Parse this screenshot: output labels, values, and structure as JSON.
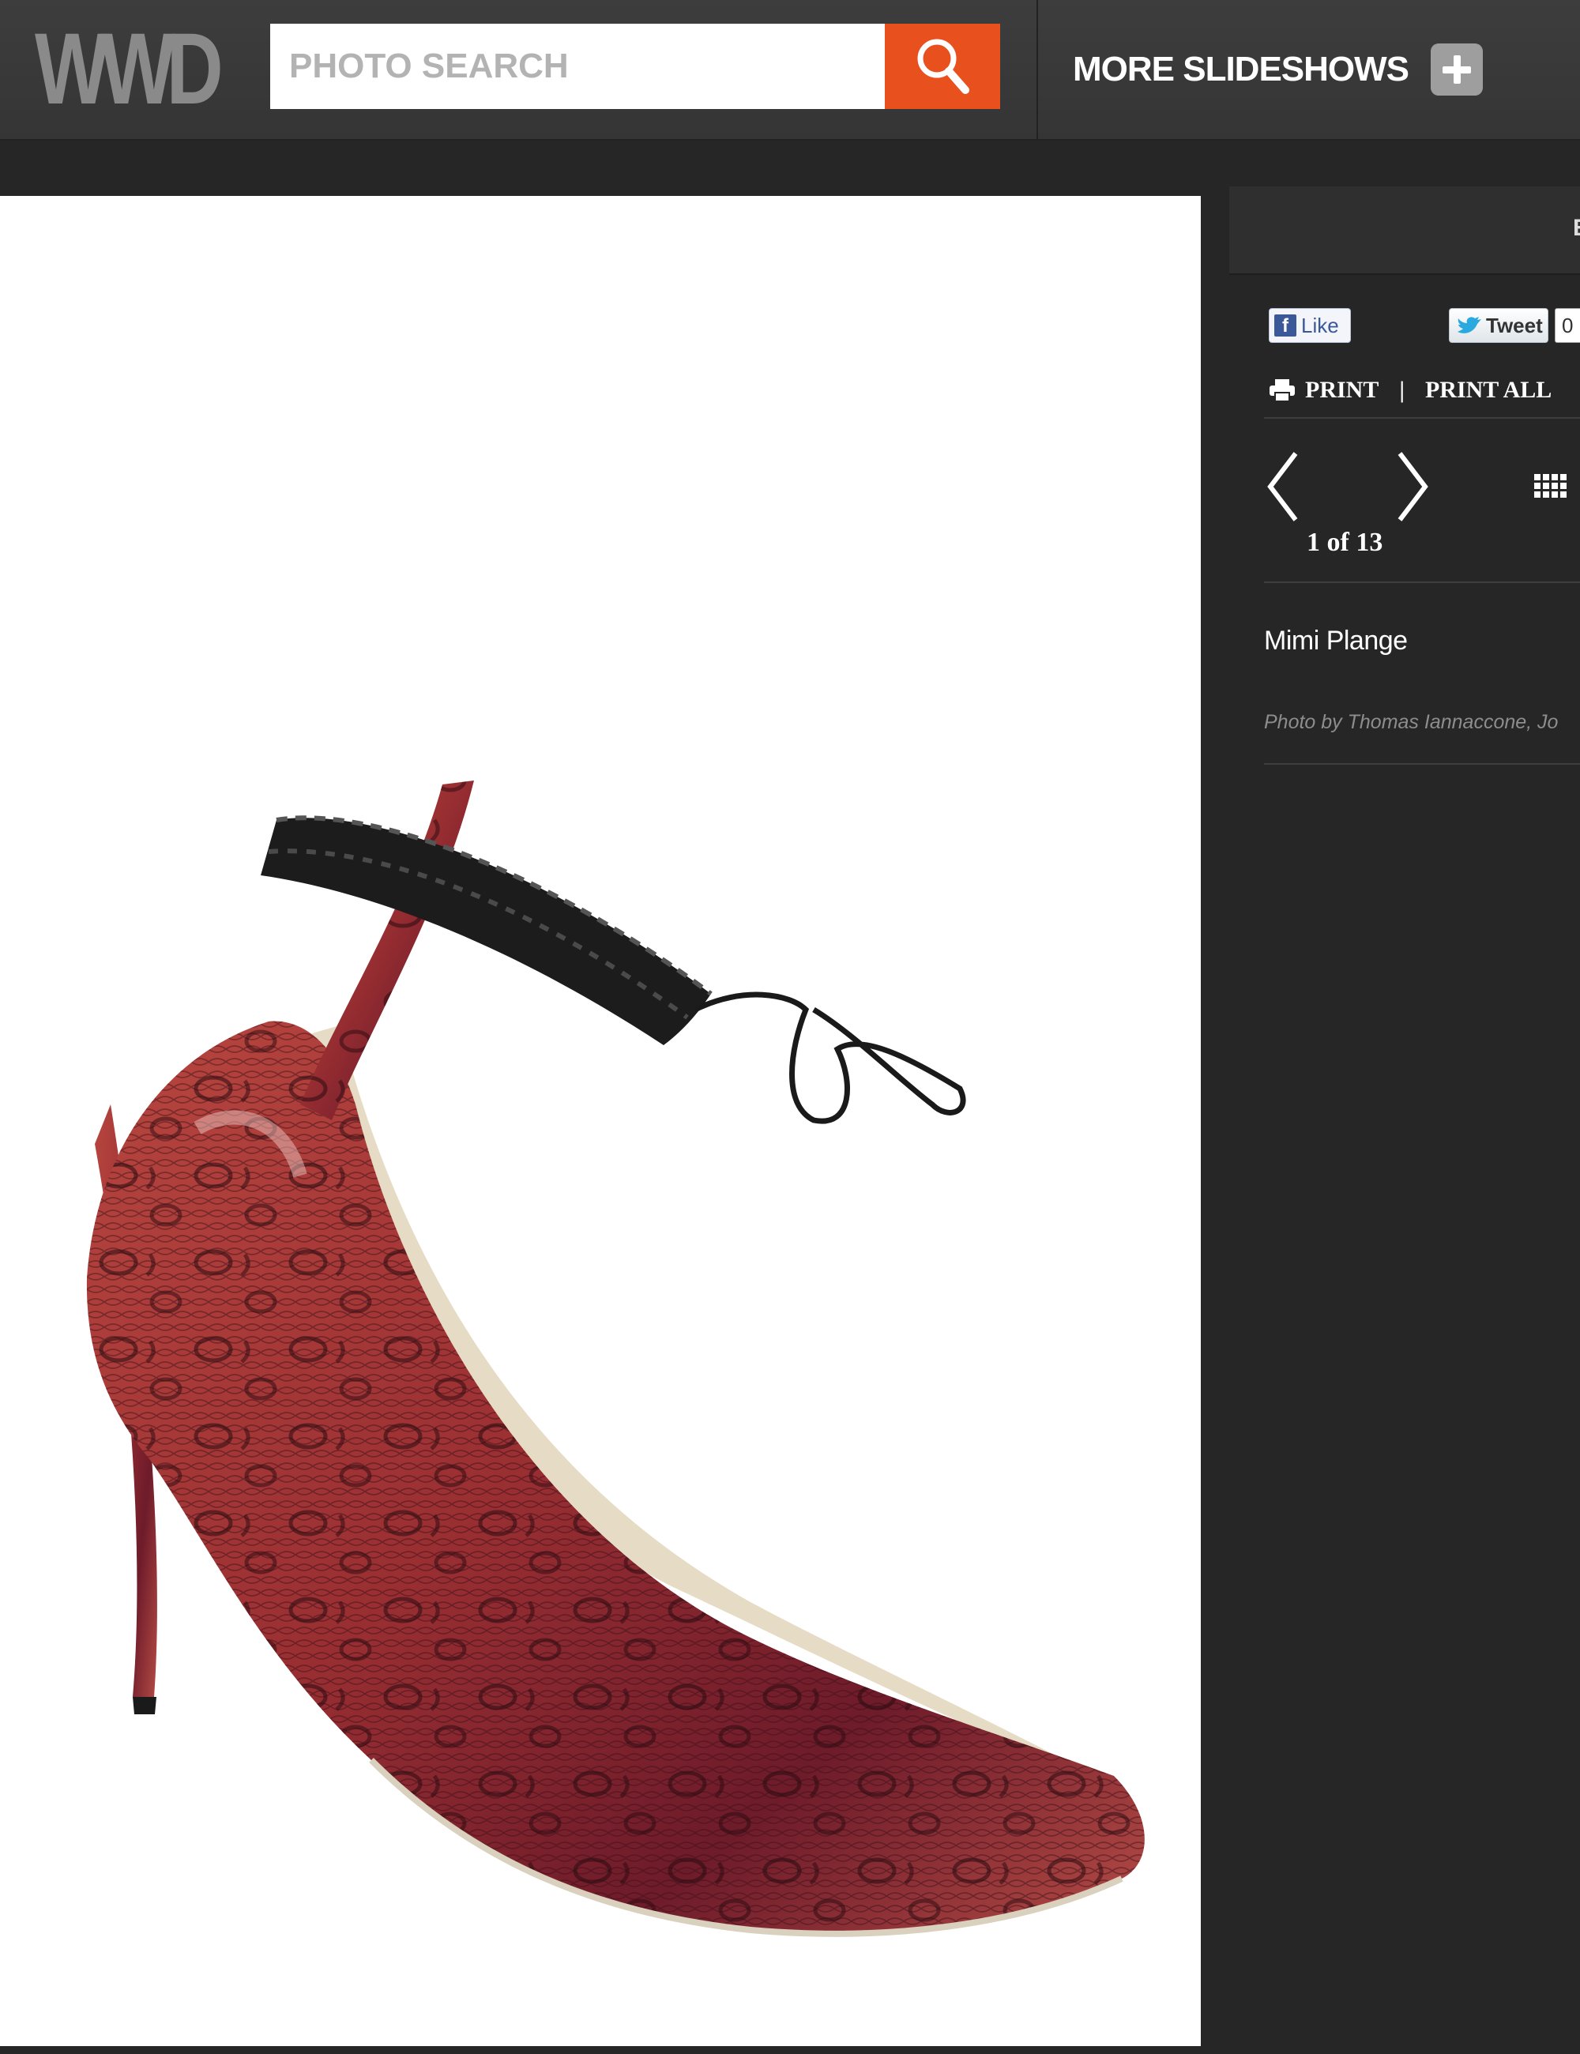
{
  "header": {
    "logo": "WWD",
    "search_placeholder": "PHOTO SEARCH",
    "search_icon": "search-icon",
    "more_slideshows_label": "MORE SLIDESHOWS",
    "plus_icon": "plus-icon",
    "accent_color": "#e8501e"
  },
  "photo": {
    "subject": "Red snakeskin high-heel pump with black woven ankle strap"
  },
  "sidebar": {
    "tab_label": "E",
    "social": {
      "like_label": "Like",
      "tweet_label": "Tweet",
      "tweet_count": "0"
    },
    "print_label": "PRINT",
    "print_separator": "|",
    "print_all_label": "PRINT ALL",
    "navigation": {
      "counter": "1 of 13",
      "prev_icon": "chevron-left-icon",
      "next_icon": "chevron-right-icon",
      "grid_icon": "grid-icon"
    },
    "slide_title": "Mimi Plange",
    "photo_credit": "Photo by Thomas Iannaccone, Jo"
  }
}
